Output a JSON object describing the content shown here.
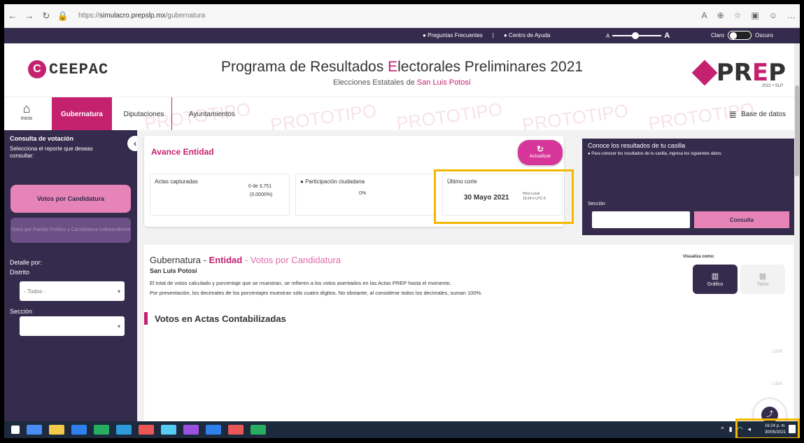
{
  "browser": {
    "url_prefix": "https://",
    "url_host": "simulacro.prepslp.mx",
    "url_path": "/gubernatura"
  },
  "topbar": {
    "faq": "Preguntas Frecuentes",
    "help": "Centro de Ayuda",
    "font_small": "A",
    "font_large": "A",
    "theme_light": "Claro",
    "theme_dark": "Oscuro"
  },
  "header": {
    "logo_text": "CEEPAC",
    "title_a": "Programa de Resultados ",
    "title_e": "E",
    "title_b": "lectorales Preliminares 2021",
    "subtitle_a": "Elecciones Estatales de ",
    "subtitle_b": "San Luis Potosí",
    "prep_a": "PR",
    "prep_e": "E",
    "prep_b": "P",
    "prep_sub": "2021 • SLP"
  },
  "nav": {
    "home_label": "Inicio",
    "tabs": [
      "Gubernatura",
      "Diputaciones",
      "Ayuntamientos"
    ],
    "watermark": "PROTOTIPO",
    "db_label": "Base de datos"
  },
  "sidebar": {
    "title": "Consulta de votación",
    "desc": "Selecciona el reporte que deseas consultar:",
    "btn_primary": "Votos por Candidatura",
    "btn_secondary": "Votos por Partido Político y Candidatura Independiente",
    "detalle_label": "Detalle por:",
    "distrito_label": "Distrito",
    "distrito_value": "- Todos -",
    "seccion_label": "Sección",
    "seccion_value": ""
  },
  "avance": {
    "title": "Avance Entidad",
    "refresh_label": "Actualizar",
    "actas_label": "Actas capturadas",
    "actas_value": "0 de 3,751",
    "actas_pct": "(0.0000%)",
    "participacion_label": "Participación ciudadana",
    "participacion_value": "0%",
    "corte_label": "Último corte",
    "corte_date": "30 Mayo 2021",
    "corte_time_1": "Hora Local",
    "corte_time_2": "16:24 h UTC-5"
  },
  "casilla": {
    "title": "Conoce los resultados de tu casilla",
    "desc": "Para conocer los resultados de tu casilla, ingresa los siguientes datos:",
    "seccion_label": "Sección",
    "button": "Consulta"
  },
  "content": {
    "title_a": "Gubernatura - ",
    "title_b": "Entidad",
    "title_c": " - Votos por Candidatura",
    "location": "San Luis Potosí",
    "text1": "El total de votos calculado y porcentaje que se muestran, se refieren a los votos asentados en las Actas PREP hasta el momento.",
    "text2": "Por presentación, los decimales de los porcentajes muestran sólo cuatro dígitos. No obstante, al considerar todos los decimales, suman 100%.",
    "viz_label": "Visualiza como:",
    "viz_graph": "Gráfico",
    "viz_table": "Tabla",
    "section_title": "Votos en Actas Contabilizadas",
    "axis_1": "2,000",
    "axis_2": "1,500"
  },
  "taskbar": {
    "time": "16:24 p. m.",
    "date": "30/05/2021"
  },
  "colors": {
    "accent": "#c4226f",
    "dark": "#342b4d",
    "highlight": "#f5b800"
  }
}
